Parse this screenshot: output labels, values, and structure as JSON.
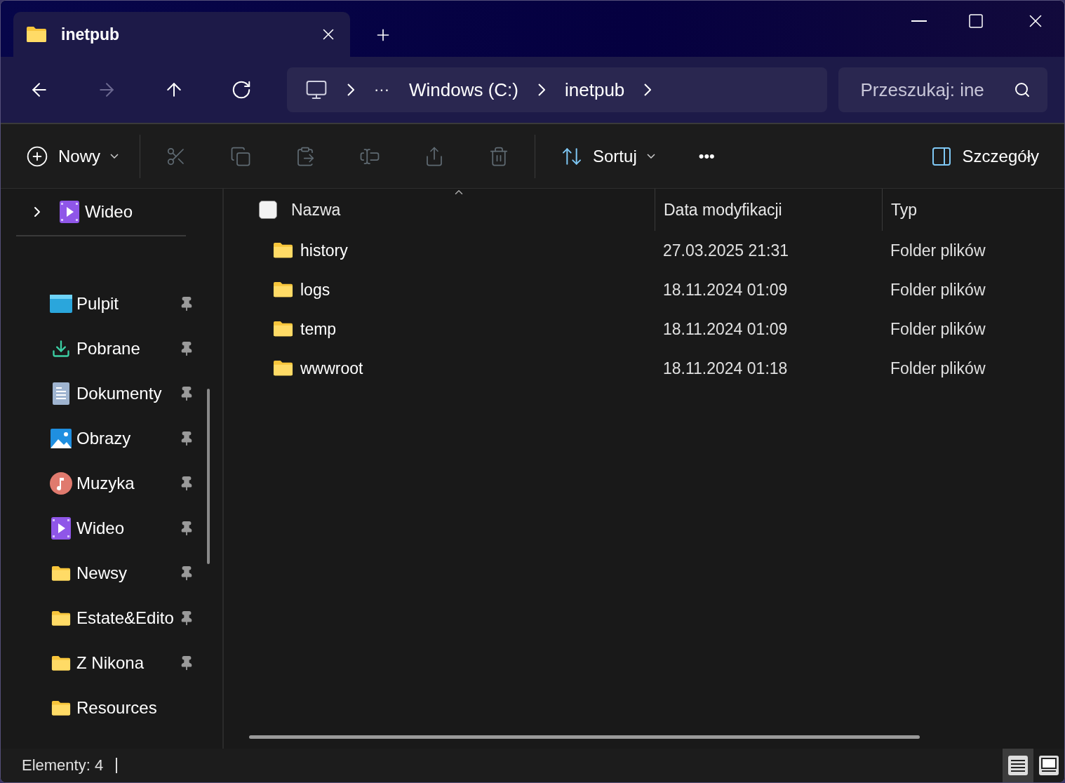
{
  "tab": {
    "title": "inetpub"
  },
  "nav": [
    {
      "kind": "back",
      "disabled": false
    },
    {
      "kind": "forward",
      "disabled": true
    },
    {
      "kind": "up",
      "disabled": false
    },
    {
      "kind": "refresh",
      "disabled": false
    }
  ],
  "breadcrumb": {
    "more": "···",
    "segments": [
      "Windows (C:)",
      "inetpub"
    ]
  },
  "search": {
    "placeholder": "Przeszukaj: ine"
  },
  "toolbar": {
    "new_label": "Nowy",
    "actions": [
      {
        "kind": "cut",
        "disabled": true
      },
      {
        "kind": "copy",
        "disabled": true
      },
      {
        "kind": "paste",
        "disabled": true
      },
      {
        "kind": "rename",
        "disabled": true
      },
      {
        "kind": "share",
        "disabled": true
      },
      {
        "kind": "delete",
        "disabled": true
      }
    ],
    "sort_label": "Sortuj",
    "more": "•••",
    "details_label": "Szczegóły"
  },
  "sidebar": {
    "top": [
      {
        "label": "Wideo",
        "kind": "video",
        "expanded": false
      }
    ],
    "items": [
      {
        "label": "Pulpit",
        "kind": "desktop",
        "pinned": true
      },
      {
        "label": "Pobrane",
        "kind": "download",
        "pinned": true
      },
      {
        "label": "Dokumenty",
        "kind": "document",
        "pinned": true
      },
      {
        "label": "Obrazy",
        "kind": "image",
        "pinned": true
      },
      {
        "label": "Muzyka",
        "kind": "music",
        "pinned": true
      },
      {
        "label": "Wideo",
        "kind": "video",
        "pinned": true
      },
      {
        "label": "Newsy",
        "kind": "folder",
        "pinned": true
      },
      {
        "label": "Estate&Edito",
        "kind": "folder",
        "pinned": true
      },
      {
        "label": "Z Nikona",
        "kind": "folder",
        "pinned": true
      },
      {
        "label": "Resources",
        "kind": "folder",
        "pinned": false
      }
    ]
  },
  "table": {
    "select_all": {
      "checked": false
    },
    "columns": [
      "Nazwa",
      "Data modyfikacji",
      "Typ"
    ],
    "rows": [
      {
        "name": "history",
        "modified": "27.03.2025 21:31",
        "type": "Folder plików"
      },
      {
        "name": "logs",
        "modified": "18.11.2024 01:09",
        "type": "Folder plików"
      },
      {
        "name": "temp",
        "modified": "18.11.2024 01:09",
        "type": "Folder plików"
      },
      {
        "name": "wwwroot",
        "modified": "18.11.2024 01:18",
        "type": "Folder plików"
      }
    ]
  },
  "status_bar": {
    "count": "Elementy: 4",
    "views": [
      {
        "kind": "details",
        "selected": true
      },
      {
        "kind": "tiles",
        "selected": false
      }
    ]
  }
}
